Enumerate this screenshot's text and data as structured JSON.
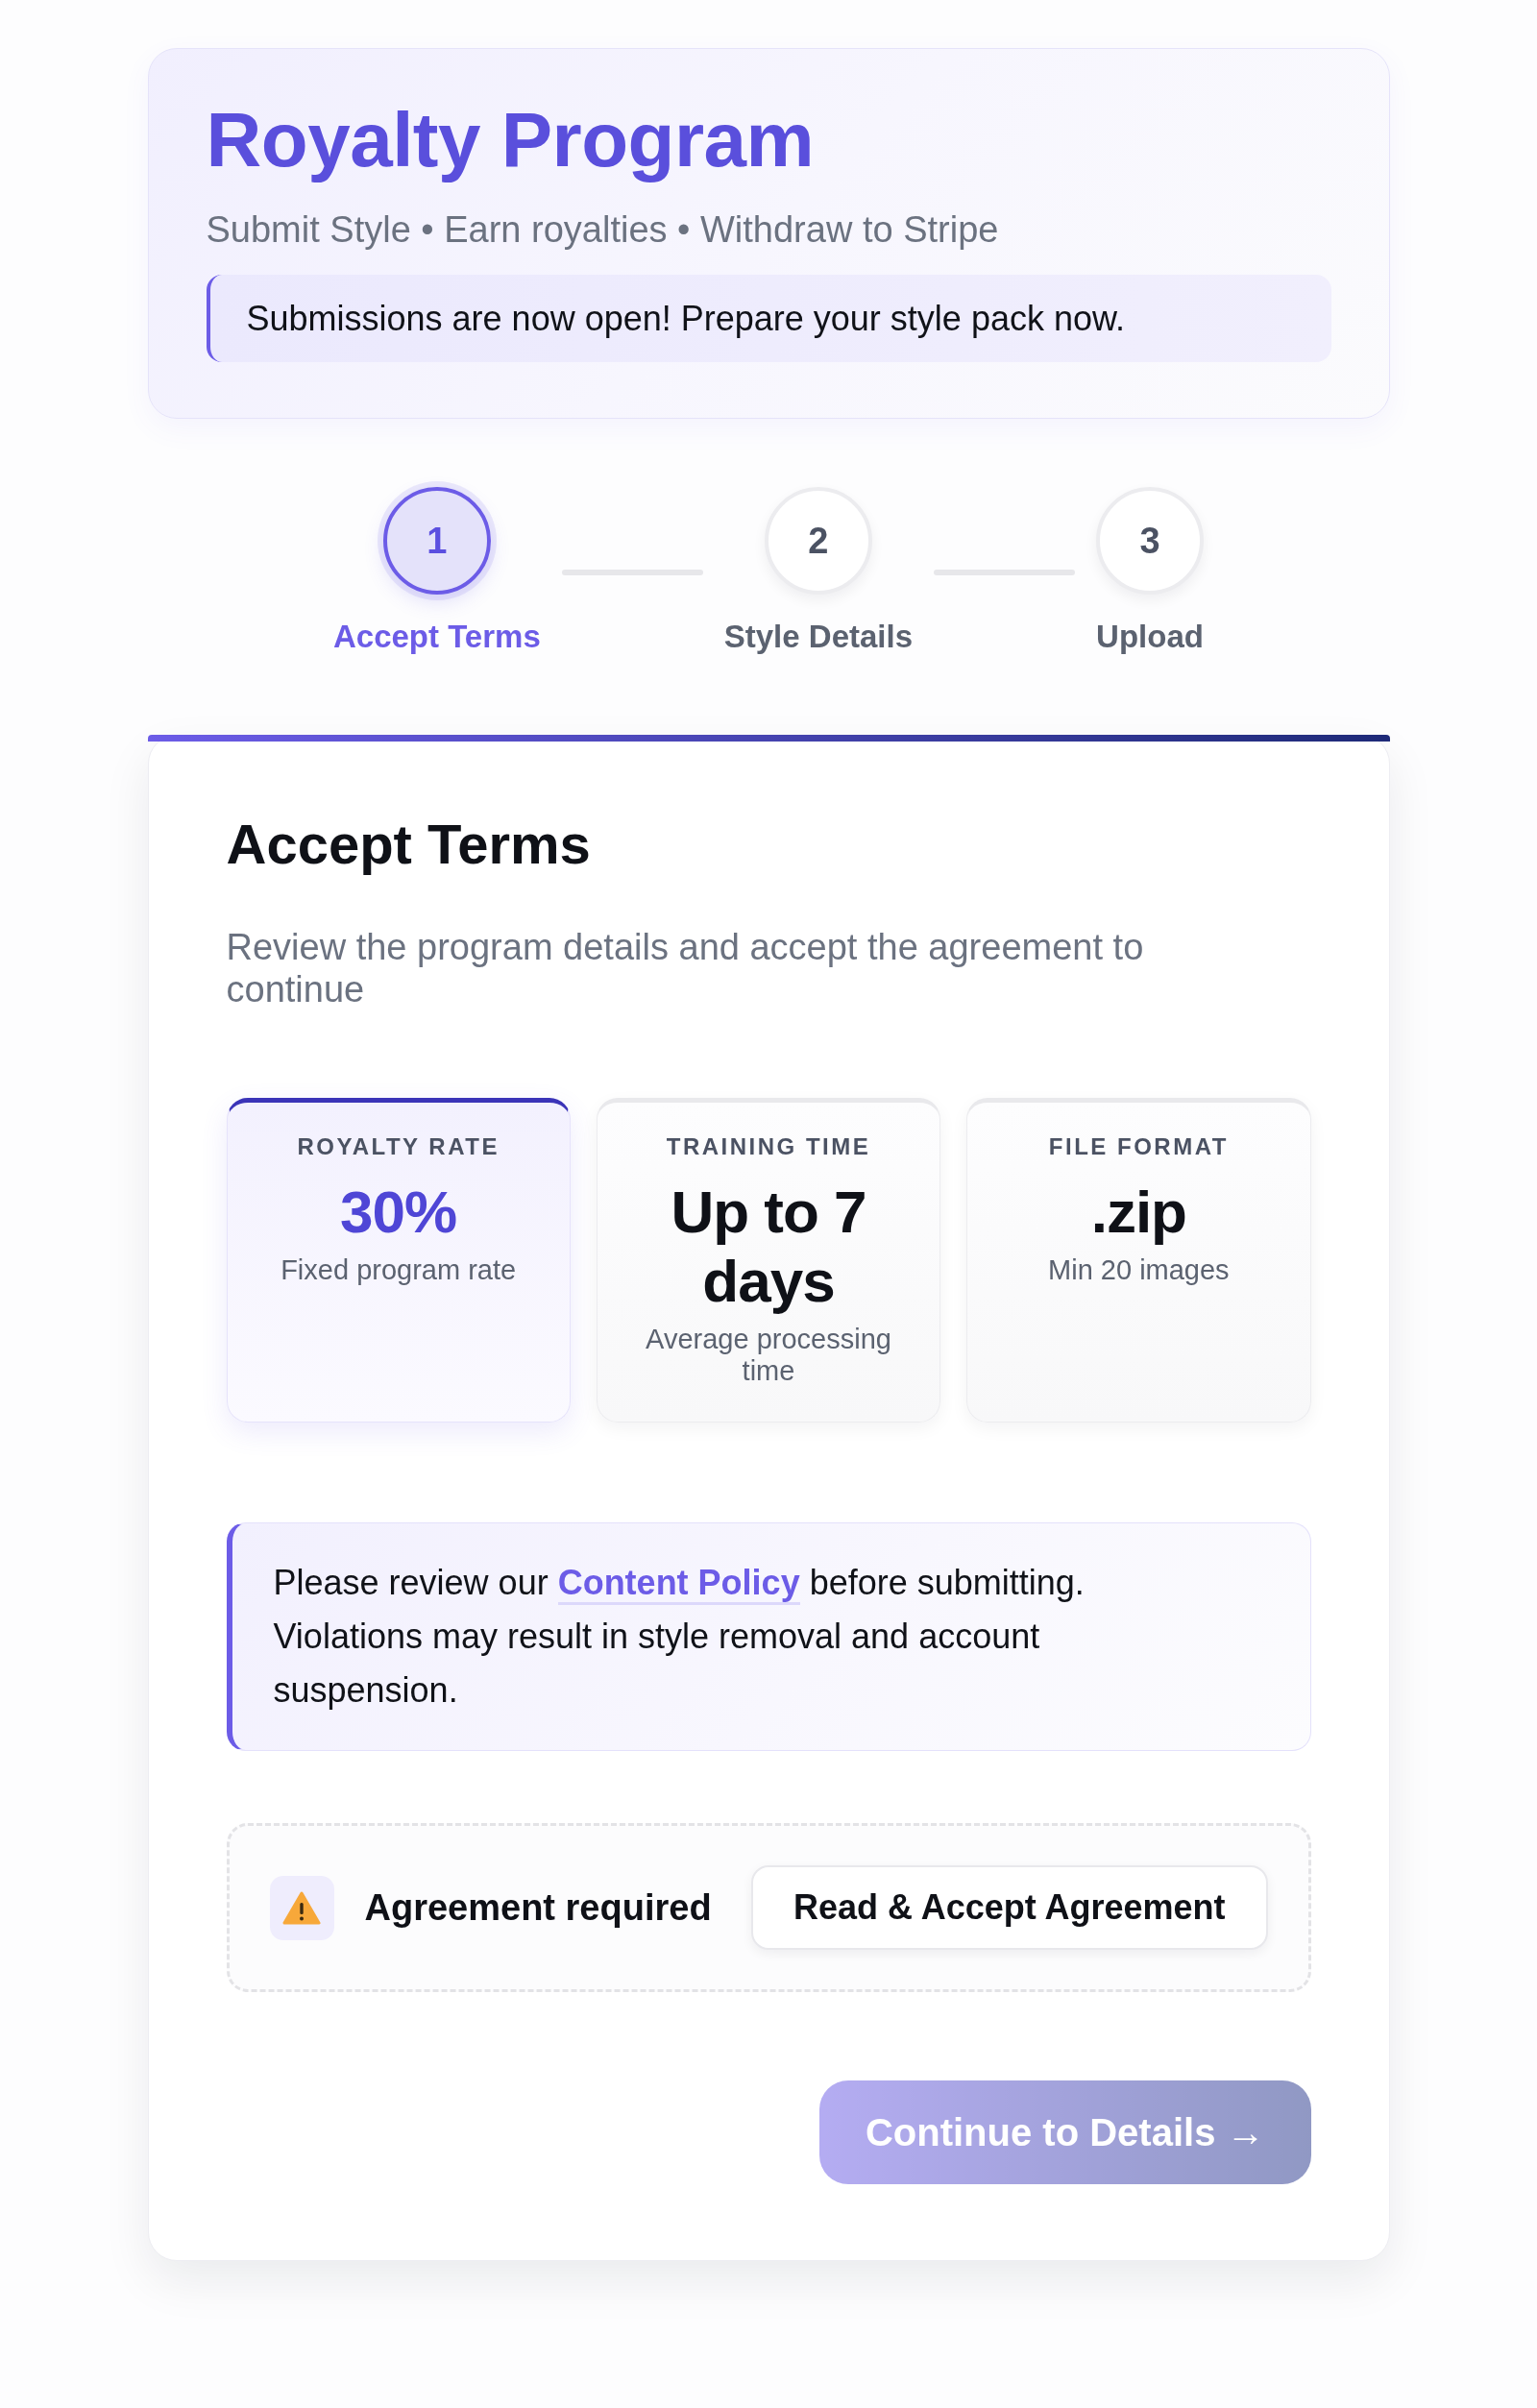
{
  "header": {
    "title": "Royalty Program",
    "subtitle": "Submit Style • Earn royalties • Withdraw to Stripe",
    "notice": "Submissions are now open! Prepare your style pack now."
  },
  "steps": [
    {
      "number": "1",
      "label": "Accept Terms",
      "selected": true
    },
    {
      "number": "2",
      "label": "Style Details",
      "selected": false
    },
    {
      "number": "3",
      "label": "Upload",
      "selected": false
    }
  ],
  "panel": {
    "title": "Accept Terms",
    "description": "Review the program details and accept the agreement to continue",
    "stats": [
      {
        "label": "ROYALTY RATE",
        "value": "30%",
        "note": "Fixed program rate",
        "highlighted": true
      },
      {
        "label": "TRAINING TIME",
        "value": "Up to 7 days",
        "note": "Average processing time",
        "highlighted": false
      },
      {
        "label": "FILE FORMAT",
        "value": ".zip",
        "note": "Min 20 images",
        "highlighted": false
      }
    ],
    "policy_note": {
      "before": "Please review our ",
      "link": "Content Policy",
      "after": " before submitting. Violations may result in style removal and account suspension."
    },
    "agreement": {
      "status": "Agreement required",
      "button": "Read & Accept Agreement"
    },
    "continue_button": {
      "label": "Continue to Details →",
      "disabled": true
    }
  }
}
